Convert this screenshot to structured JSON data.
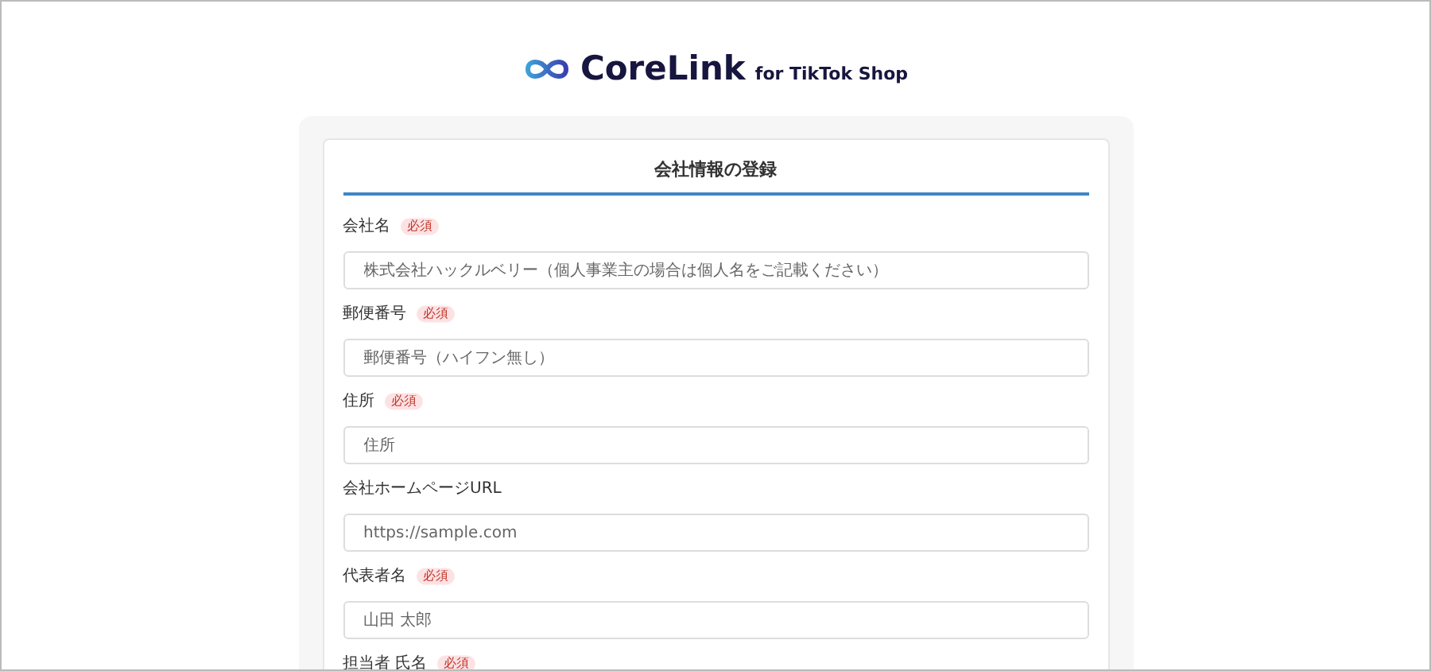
{
  "logo": {
    "name": "CoreLink",
    "tagline": "for TikTok Shop"
  },
  "form": {
    "title": "会社情報の登録",
    "fields": [
      {
        "label": "会社名",
        "badge": "必須",
        "placeholder": "株式会社ハックルベリー（個人事業主の場合は個人名をご記載ください）"
      },
      {
        "label": "郵便番号",
        "badge": "必須",
        "placeholder": "郵便番号（ハイフン無し）"
      },
      {
        "label": "住所",
        "badge": "必須",
        "placeholder": "住所"
      },
      {
        "label": "会社ホームページURL",
        "placeholder": "https://sample.com"
      },
      {
        "label": "代表者名",
        "badge": "必須",
        "placeholder": "山田 太郎"
      },
      {
        "label": "担当者 氏名",
        "badge": "必須"
      }
    ]
  }
}
